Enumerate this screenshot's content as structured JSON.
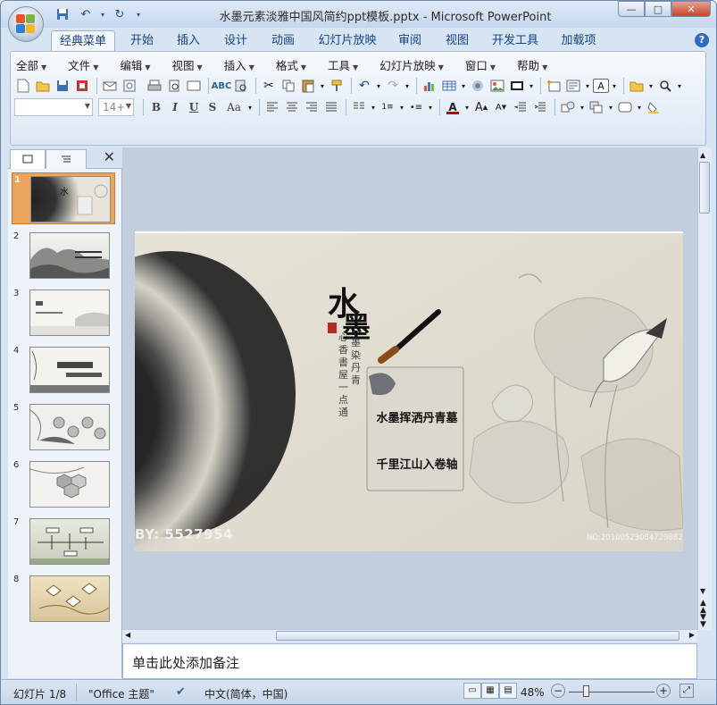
{
  "window": {
    "title": "水墨元素淡雅中国风简约ppt模板.pptx - Microsoft PowerPoint",
    "controls": [
      "—",
      "□",
      "✕"
    ]
  },
  "ribbon_tabs": [
    "经典菜单",
    "开始",
    "插入",
    "设计",
    "动画",
    "幻灯片放映",
    "审阅",
    "视图",
    "开发工具",
    "加载项"
  ],
  "menus": [
    "全部",
    "文件",
    "编辑",
    "视图",
    "插入",
    "格式",
    "工具",
    "幻灯片放映",
    "窗口",
    "帮助"
  ],
  "font_size_placeholder": "14+",
  "format_buttons": [
    "B",
    "I",
    "U",
    "S",
    "Aa"
  ],
  "slide": {
    "title_chars": [
      "水",
      "墨"
    ],
    "text_line1": "水墨挥洒丹青墓",
    "text_line2": "千里江山入卷轴",
    "watermark_left": "BY: 5527954",
    "watermark_right": "NO:20100523084729882097"
  },
  "thumbnails": [
    {
      "num": "1",
      "selected": true
    },
    {
      "num": "2",
      "selected": false
    },
    {
      "num": "3",
      "selected": false
    },
    {
      "num": "4",
      "selected": false
    },
    {
      "num": "5",
      "selected": false
    },
    {
      "num": "6",
      "selected": false
    },
    {
      "num": "7",
      "selected": false
    },
    {
      "num": "8",
      "selected": false
    }
  ],
  "notes_placeholder": "单击此处添加备注",
  "status": {
    "slide_info": "幻灯片 1/8",
    "theme": "\"Office 主题\"",
    "language": "中文(简体，中国)",
    "zoom": "48%"
  }
}
